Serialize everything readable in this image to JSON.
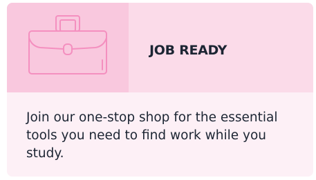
{
  "card": {
    "title": "JOB READY",
    "description": "Join our one-stop shop for the essential tools you need to find work while you study.",
    "icon": "briefcase-icon",
    "colors": {
      "header_bg": "#fbdbe9",
      "icon_bg": "#f9c8de",
      "icon_stroke": "#f48fbf",
      "body_bg": "#fdf0f6",
      "text": "#1c2533"
    }
  }
}
